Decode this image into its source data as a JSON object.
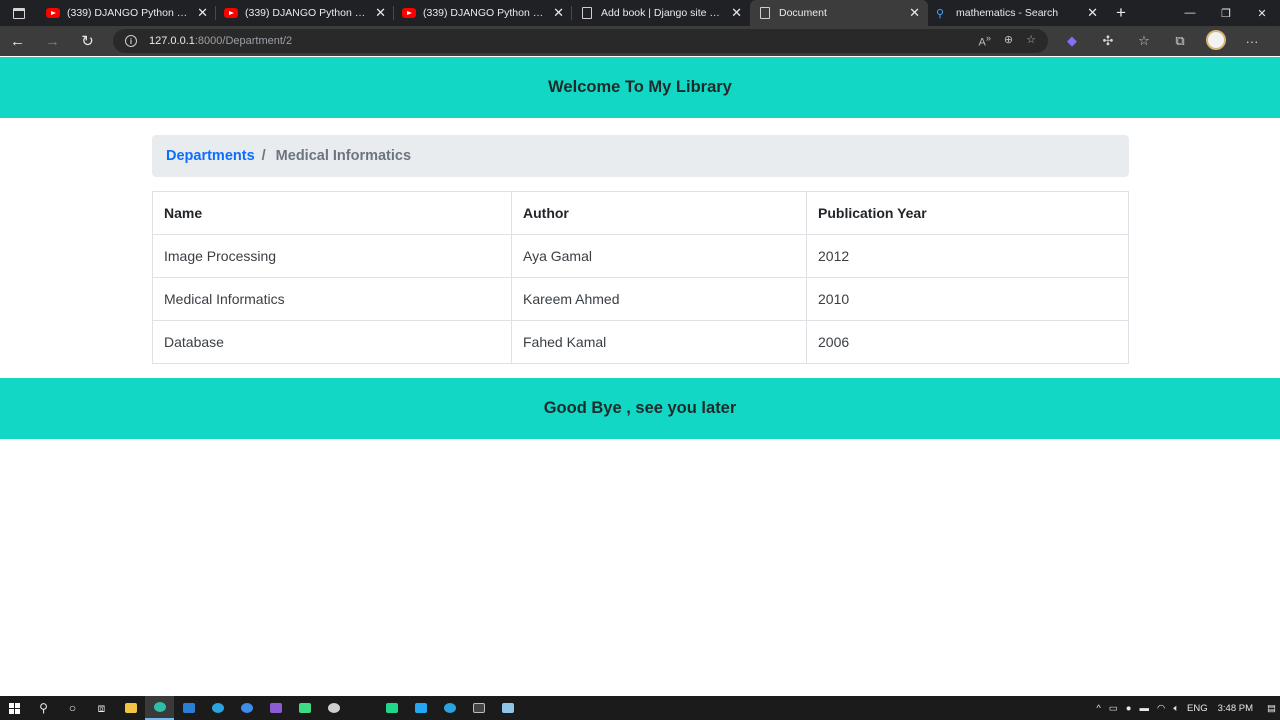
{
  "browser": {
    "tabs": [
      {
        "title": "(339) DJANGO Python Lesson",
        "icon": "youtube-icon",
        "active": false
      },
      {
        "title": "(339) DJANGO Python Lesson",
        "icon": "youtube-icon",
        "active": false
      },
      {
        "title": "(339) DJANGO Python Lesson",
        "icon": "youtube-icon",
        "active": false
      },
      {
        "title": "Add book | Django site admin",
        "icon": "document-icon",
        "active": false
      },
      {
        "title": "Document",
        "icon": "document-icon",
        "active": true
      },
      {
        "title": "mathematics - Search",
        "icon": "search-icon",
        "active": false
      }
    ],
    "url": {
      "host": "127.0.0.1",
      "rest": ":8000/Department/2"
    },
    "colors": {
      "tabstrip": "#202124",
      "toolbar": "#3c3c3c"
    }
  },
  "page": {
    "header": "Welcome To My Library",
    "breadcrumb": {
      "link": "Departments",
      "separator": "/",
      "current": "Medical Informatics"
    },
    "table": {
      "headers": [
        "Name",
        "Author",
        "Publication Year"
      ],
      "rows": [
        [
          "Image Processing",
          "Aya Gamal",
          "2012"
        ],
        [
          "Medical Informatics",
          "Kareem Ahmed",
          "2010"
        ],
        [
          "Database",
          "Fahed Kamal",
          "2006"
        ]
      ]
    },
    "footer": "Good Bye , see you later",
    "colors": {
      "banner": "#12d7c4",
      "link": "#0d6efd",
      "breadcrumb_bg": "#e9ecef"
    }
  },
  "taskbar": {
    "language": "ENG",
    "time": "3:48 PM"
  }
}
